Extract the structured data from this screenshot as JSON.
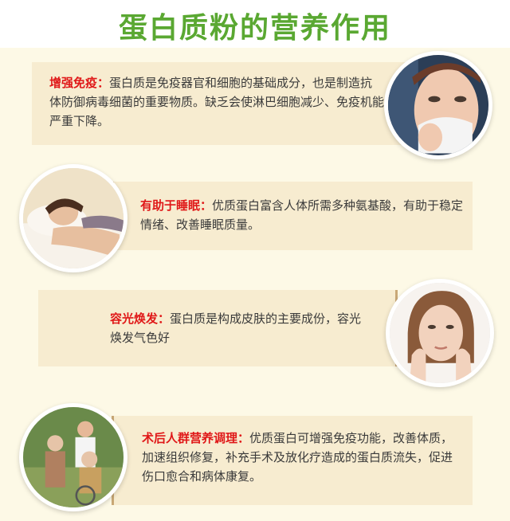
{
  "title": "蛋白质粉的营养作用",
  "sections": [
    {
      "keyword": "增强免疫",
      "text": "蛋白质是免疫器官和细胞的基础成分，也是制造抗体防御病毒细菌的重要物质。缺乏会使淋巴细胞减少、免疫机能严重下降。",
      "image": "sneezing-woman-photo"
    },
    {
      "keyword": "有助于睡眠",
      "text": "优质蛋白富含人体所需多种氨基酸，有助于稳定情绪、改善睡眠质量。",
      "image": "sleeping-woman-photo"
    },
    {
      "keyword": "容光焕发",
      "text": "蛋白质是构成皮肤的主要成份，容光焕发气色好",
      "image": "woman-face-photo"
    },
    {
      "keyword": "术后人群营养调理",
      "text": "优质蛋白可增强免疫功能，改善体质，加速组织修复，补充手术及放化疗造成的蛋白质流失，促进伤口愈合和病体康复。",
      "image": "elderly-family-photo"
    }
  ],
  "colors": {
    "title": "#5aa832",
    "keyword": "#e01818",
    "card": "#f7ecd0",
    "background": "#fdf9e6"
  }
}
